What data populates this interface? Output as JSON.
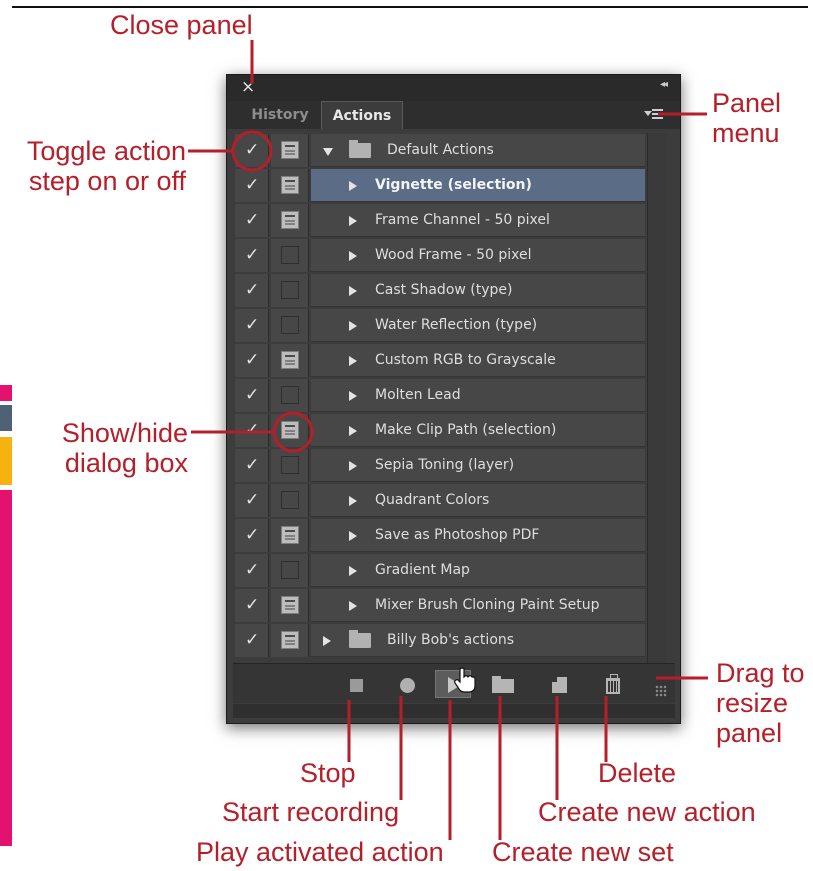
{
  "callouts": {
    "close_panel": "Close panel",
    "panel_menu": [
      "Panel",
      "menu"
    ],
    "toggle_action": [
      "Toggle action",
      "step on or off"
    ],
    "show_hide_dialog": [
      "Show/hide",
      "dialog box"
    ],
    "drag_resize": [
      "Drag to",
      "resize",
      "panel"
    ],
    "stop": "Stop",
    "start_recording": "Start recording",
    "play_activated": "Play activated action",
    "create_new_set": "Create new set",
    "create_new_action": "Create new action",
    "delete": "Delete"
  },
  "panel": {
    "close_glyph": "×",
    "collapse_glyph": "◂◂",
    "tabs": [
      {
        "label": "History",
        "active": false
      },
      {
        "label": "Actions",
        "active": true
      }
    ],
    "rows": [
      {
        "label": "Default Actions",
        "type": "set",
        "expanded": true,
        "checked": true,
        "dialog": true,
        "selected": false
      },
      {
        "label": "Vignette (selection)",
        "type": "action",
        "checked": true,
        "dialog": true,
        "selected": true
      },
      {
        "label": "Frame Channel - 50 pixel",
        "type": "action",
        "checked": true,
        "dialog": true,
        "selected": false
      },
      {
        "label": "Wood Frame - 50 pixel",
        "type": "action",
        "checked": true,
        "dialog": false,
        "selected": false
      },
      {
        "label": "Cast Shadow (type)",
        "type": "action",
        "checked": true,
        "dialog": false,
        "selected": false
      },
      {
        "label": "Water Reflection (type)",
        "type": "action",
        "checked": true,
        "dialog": false,
        "selected": false
      },
      {
        "label": "Custom RGB to Grayscale",
        "type": "action",
        "checked": true,
        "dialog": true,
        "selected": false
      },
      {
        "label": "Molten Lead",
        "type": "action",
        "checked": true,
        "dialog": false,
        "selected": false
      },
      {
        "label": "Make Clip Path (selection)",
        "type": "action",
        "checked": true,
        "dialog": true,
        "selected": false
      },
      {
        "label": "Sepia Toning (layer)",
        "type": "action",
        "checked": true,
        "dialog": false,
        "selected": false
      },
      {
        "label": "Quadrant Colors",
        "type": "action",
        "checked": true,
        "dialog": false,
        "selected": false
      },
      {
        "label": "Save as Photoshop PDF",
        "type": "action",
        "checked": true,
        "dialog": true,
        "selected": false
      },
      {
        "label": "Gradient Map",
        "type": "action",
        "checked": true,
        "dialog": false,
        "selected": false
      },
      {
        "label": "Mixer Brush Cloning Paint Setup",
        "type": "action",
        "checked": true,
        "dialog": true,
        "selected": false
      },
      {
        "label": "Billy Bob's actions",
        "type": "set",
        "expanded": false,
        "checked": true,
        "dialog": true,
        "selected": false
      }
    ],
    "check_glyph": "✓",
    "bottom_buttons": [
      "stop-icon",
      "record-icon",
      "play-icon",
      "new-set-icon",
      "new-action-icon",
      "trash-icon"
    ]
  },
  "colors": {
    "callout": "#b51f2a",
    "panel_bg": "#3c3c3c",
    "selected_row": "#5a6c86"
  }
}
